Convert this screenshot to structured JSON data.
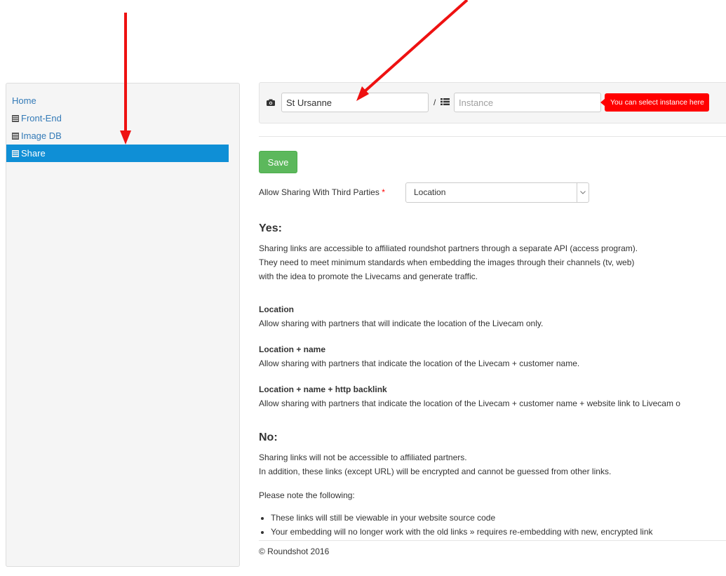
{
  "sidebar": {
    "items": [
      {
        "label": "Home",
        "icon": null,
        "active": false
      },
      {
        "label": "Front-End",
        "icon": "list-icon",
        "active": false
      },
      {
        "label": "Image DB",
        "icon": "list-icon",
        "active": false
      },
      {
        "label": "Share",
        "icon": "list-icon",
        "active": true
      }
    ]
  },
  "toolbar": {
    "camera_value": "St Ursanne",
    "separator": "/",
    "instance_placeholder": "Instance",
    "tooltip": "You can select instance here"
  },
  "form": {
    "save_label": "Save",
    "sharing_label": "Allow Sharing With Third Parties",
    "required_mark": "*",
    "sharing_value": "Location"
  },
  "yes": {
    "title": "Yes:",
    "lines": [
      "Sharing links are accessible to affiliated roundshot partners through a separate API (access program).",
      "They need to meet minimum standards when embedding the images through their channels (tv, web)",
      "with the idea to promote the Livecams and generate traffic."
    ],
    "options": [
      {
        "title": "Location",
        "desc": "Allow sharing with partners that will indicate the location of the Livecam only."
      },
      {
        "title": "Location + name",
        "desc": "Allow sharing with partners that indicate the location of the Livecam + customer name."
      },
      {
        "title": "Location + name + http backlink",
        "desc": "Allow sharing with partners that indicate the location of the Livecam + customer name + website link to Livecam o"
      }
    ]
  },
  "no": {
    "title": "No:",
    "lines": [
      "Sharing links will not be accessible to affiliated partners.",
      "In addition, these links (except URL) will be encrypted and cannot be guessed from other links."
    ],
    "note": "Please note the following:",
    "bullets": [
      "These links will still be viewable in your website source code",
      "Your embedding will no longer work with the old links » requires re-embedding with new, encrypted link"
    ]
  },
  "footer": "© Roundshot 2016",
  "colors": {
    "active": "#0f8fd6",
    "save": "#5cb85c",
    "tooltip": "#ff0000",
    "arrow": "#ee1111",
    "link": "#337ab7"
  }
}
